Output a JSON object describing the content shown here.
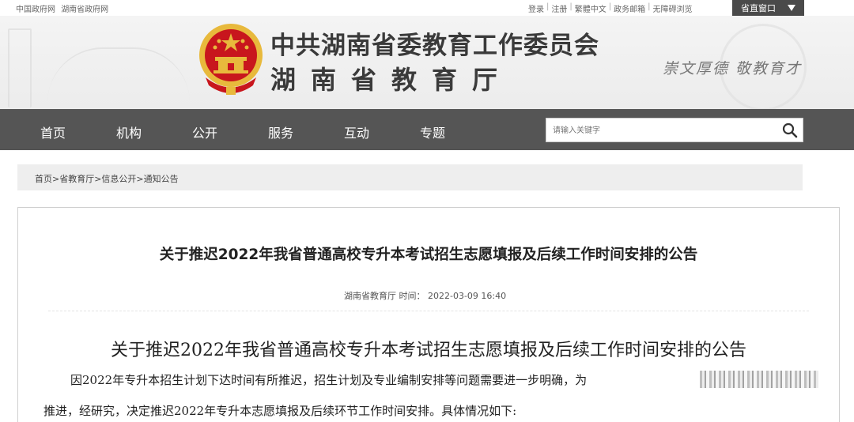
{
  "topbar": {
    "left_links": [
      "中国政府网",
      "湖南省政府网"
    ],
    "right_links": [
      "登录",
      "注册",
      "繁體中文",
      "政务邮箱",
      "无障碍浏览"
    ],
    "portal_label": "省直窗口"
  },
  "header": {
    "title_main": "中共湖南省委教育工作委员会",
    "title_sub": "湖南省教育厅",
    "motto": "崇文厚德 敬教育才"
  },
  "nav": {
    "items": [
      "首页",
      "机构",
      "公开",
      "服务",
      "互动",
      "专题"
    ],
    "search_placeholder": "请输入关键字"
  },
  "breadcrumb": "首页>省教育厅>信息公开>通知公告",
  "article": {
    "title": "关于推迟2022年我省普通高校专升本考试招生志愿填报及后续工作时间安排的公告",
    "source": "湖南省教育厅",
    "time_label": "时间：",
    "time": "2022-03-09 16:40",
    "body_title": "关于推迟2022年我省普通高校专升本考试招生志愿填报及后续工作时间安排的公告",
    "para1": "因2022年专升本招生计划下达时间有所推迟，招生计划及专业编制安排等问题需要进一步明确，为",
    "para2": "推进，经研究，决定推迟2022年专升本志愿填报及后续环节工作时间安排。具体情况如下:"
  },
  "colors": {
    "nav_bg": "#555555",
    "portal_bg": "#4a4a4a",
    "emblem_red": "#c8161d",
    "emblem_gold": "#e8b93c"
  },
  "icons": [
    "national-emblem-icon",
    "search-icon",
    "caret-down-icon"
  ]
}
